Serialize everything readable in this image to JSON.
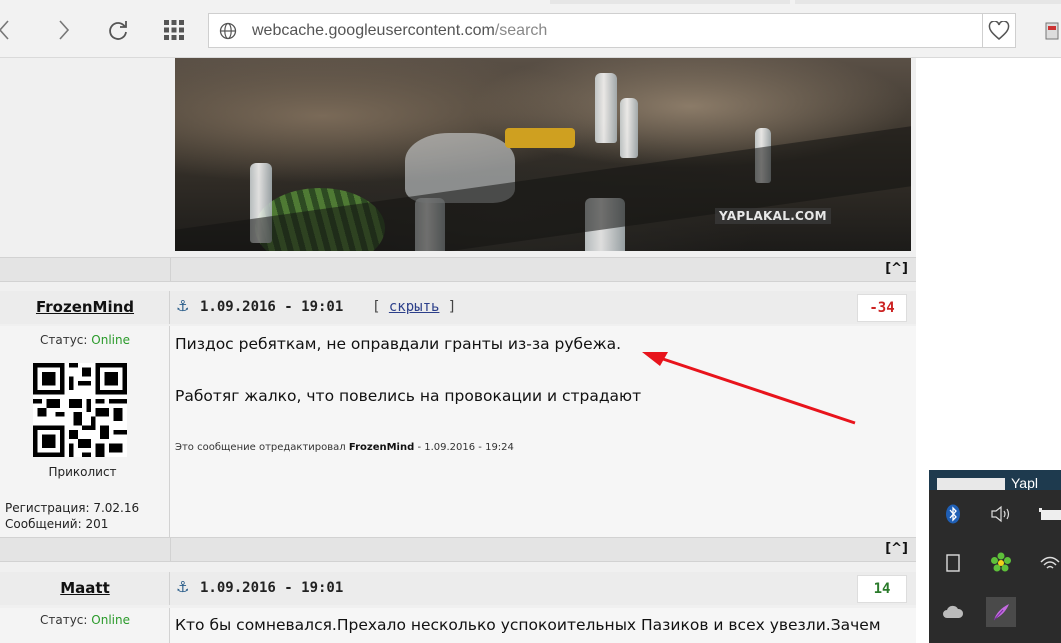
{
  "browser": {
    "back_icon": "chevron-left-icon",
    "forward_icon": "chevron-right-icon",
    "reload_icon": "reload-icon",
    "apps_icon": "grid-icon",
    "url_domain": "webcache.googleusercontent.com",
    "url_path": "/search",
    "favorite_icon": "heart-icon"
  },
  "image": {
    "watermark": "YAPLAKAL.COM"
  },
  "nav": {
    "to_top": "[^]"
  },
  "posts": [
    {
      "username": "FrozenMind",
      "date": "1.09.2016 - 19:01",
      "hide_open": "[",
      "hide_label": "скрыть",
      "hide_close": "]",
      "score": "-34",
      "score_color": "#cc2222",
      "status_label": "Статус:",
      "status_value": "Online",
      "rank": "Приколист",
      "registration": "Регистрация: 7.02.16",
      "messages": "Сообщений: 201",
      "text_line1": "Пиздос ребяткам, не оправдали гранты из-за рубежа.",
      "text_line2": "Работяг жалко, что повелись на провокации и страдают",
      "edited_prefix": "Это сообщение отредактировал",
      "edited_user": "FrozenMind",
      "edited_suffix": "- 1.09.2016 - 19:24"
    },
    {
      "username": "Maatt",
      "date": "1.09.2016 - 19:01",
      "score": "14",
      "score_color": "#2a7a2a",
      "status_label": "Статус:",
      "status_value": "Online",
      "text_line1": "Кто бы сомневался.Прехало несколько успокоительных Пазиков и всех увезли.Зачем"
    }
  ],
  "tray": {
    "header_text": "Yapl",
    "icons": [
      "bluetooth-icon",
      "volume-icon",
      "battery-icon",
      "device-icon",
      "icq-flower-icon",
      "wifi-icon",
      "cloud-icon",
      "feather-icon"
    ]
  }
}
